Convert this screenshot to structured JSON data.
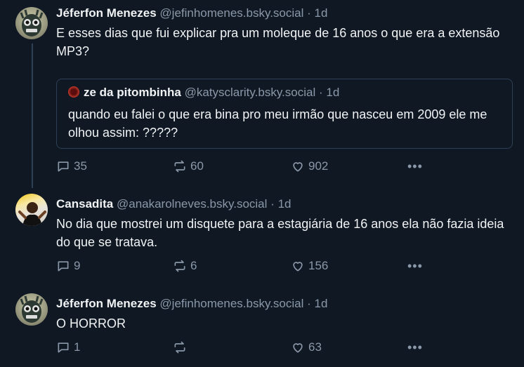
{
  "posts": [
    {
      "author": "Jéferfon Menezes",
      "handle": "@jefinhomenes.bsky.social",
      "sep": "·",
      "time": "1d",
      "text": "E esses dias que fui explicar pra um moleque de 16 anos o que era a extensão MP3?",
      "quote": {
        "author": "ze da pitombinha",
        "handle": "@katysclarity.bsky.social",
        "sep": "·",
        "time": "1d",
        "text": "quando eu falei o que era bina pro meu irmão que nasceu em 2009 ele me olhou assim: ?????"
      },
      "replies": "35",
      "reposts": "60",
      "likes": "902"
    },
    {
      "author": "Cansadita",
      "handle": "@anakarolneves.bsky.social",
      "sep": "·",
      "time": "1d",
      "text": "No dia que mostrei um disquete para a estagiária de 16 anos ela não fazia ideia do que se tratava.",
      "replies": "9",
      "reposts": "6",
      "likes": "156"
    },
    {
      "author": "Jéferfon Menezes",
      "handle": "@jefinhomenes.bsky.social",
      "sep": "·",
      "time": "1d",
      "text": "O HORROR",
      "replies": "1",
      "reposts": "",
      "likes": "63"
    }
  ],
  "more_label": "•••",
  "icons": {
    "reply": "reply-icon",
    "repost": "repost-icon",
    "like": "heart-icon",
    "more": "more-icon"
  },
  "colors": {
    "background": "#0f1823",
    "muted": "#8b98a9",
    "border": "#2e4055"
  }
}
